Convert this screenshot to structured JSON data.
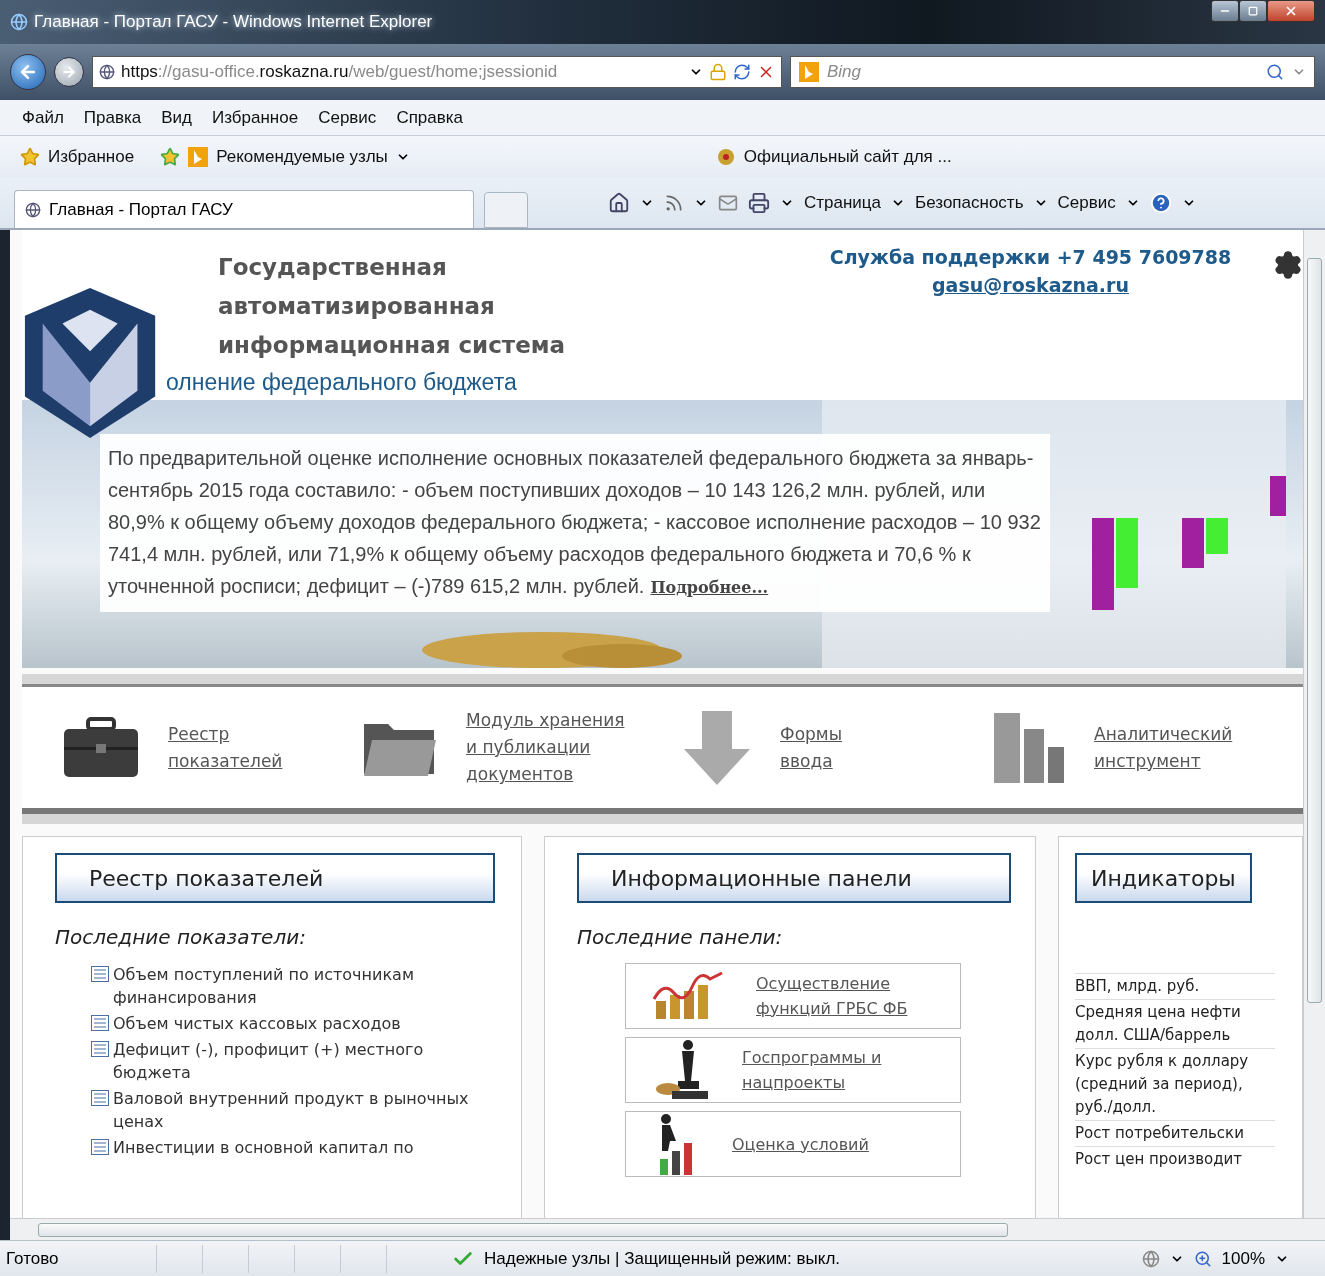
{
  "window": {
    "title": "Главная - Портал ГАСУ - Windows Internet Explorer"
  },
  "address_bar": {
    "url_parts": [
      {
        "text": "https",
        "strong": true
      },
      {
        "text": "://gasu-office.",
        "strong": false
      },
      {
        "text": "roskazna.ru",
        "strong": true
      },
      {
        "text": "/web/guest/home;jsessionid",
        "strong": false
      }
    ],
    "search_placeholder": "Bing"
  },
  "menu": [
    "Файл",
    "Правка",
    "Вид",
    "Избранное",
    "Сервис",
    "Справка"
  ],
  "favorites_bar": {
    "favorites": "Избранное",
    "suggested": "Рекомендуемые узлы",
    "site": "Официальный сайт для ..."
  },
  "tab": {
    "title": "Главная - Портал ГАСУ"
  },
  "command_bar": [
    "Страница",
    "Безопасность",
    "Сервис"
  ],
  "header": {
    "title_lines": [
      "Государственная",
      "автоматизированная",
      "информационная система"
    ],
    "subtitle": "олнение федерального бюджета",
    "support": "Служба поддержки +7 495 7609788",
    "email": "gasu@roskazna.ru"
  },
  "news": {
    "text": "По предварительной оценке исполнение основных показателей федерального бюджета за январь-сентябрь 2015 года составило: - объем поступивших доходов – 10 143 126,2 млн. рублей, или 80,9% к общему объему доходов федерального бюджета; - кассовое исполнение расходов – 10 932 741,4 млн. рублей, или 71,9% к общему объему расходов федерального бюджета и 70,6 % к уточненной росписи; дефицит – (-)789 615,2 млн. рублей.",
    "link": "Подробнее..."
  },
  "shortcuts": [
    {
      "kind": "briefcase",
      "label": "Реестр показателей"
    },
    {
      "kind": "folder",
      "label": "Модуль хранения и публикации документов"
    },
    {
      "kind": "arrow",
      "label": "Формы ввода"
    },
    {
      "kind": "bars",
      "label": "Аналитический инструмент"
    }
  ],
  "registry_panel": {
    "title": "Реестр показателей",
    "subtitle": "Последние показатели:",
    "items": [
      "Объем поступлений по источникам финансирования",
      "Объем чистых кассовых расходов",
      "Дефицит (-), профицит (+) местного бюджета",
      "Валовой внутренний продукт в рыночных ценах",
      "Инвестиции в основной капитал по"
    ]
  },
  "info_panel": {
    "title": "Информационные панели",
    "subtitle": "Последние панели:",
    "items": [
      {
        "kind": "coins",
        "label": "Осуществление функций ГРБС ФБ"
      },
      {
        "kind": "chess",
        "label": "Госпрограммы и нацпроекты"
      },
      {
        "kind": "climber",
        "label": "Оценка условий"
      }
    ]
  },
  "indicators_panel": {
    "title": "Индикаторы",
    "items": [
      "ВВП, млрд. руб.",
      "Средняя цена нефти долл. США/баррель",
      "Курс рубля к доллару (средний за период), руб./долл.",
      "Рост потребительски",
      "Рост цен производит"
    ]
  },
  "status_bar": {
    "status": "Готово",
    "security": "Надежные узлы | Защищенный режим: выкл.",
    "zoom": "100%"
  }
}
